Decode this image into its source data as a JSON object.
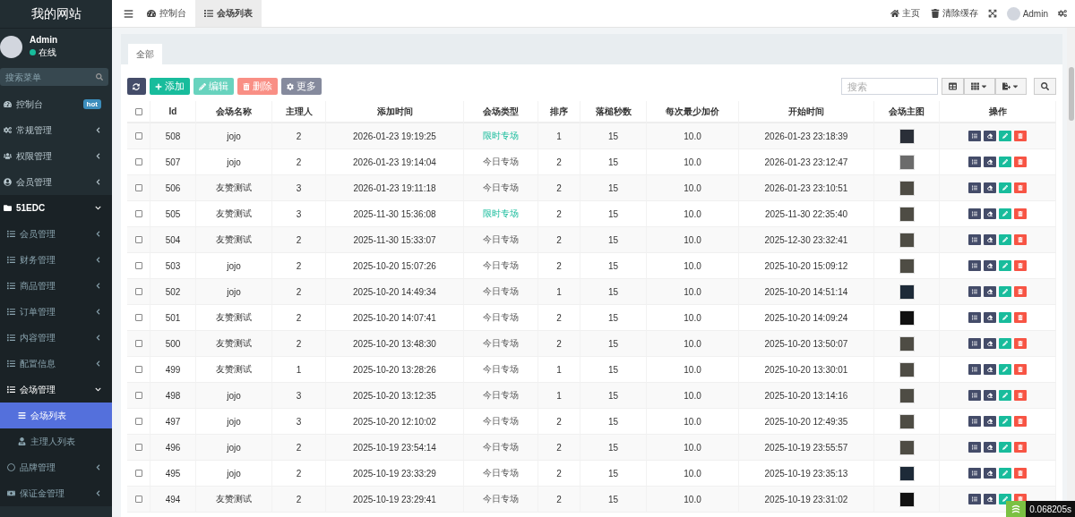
{
  "sidebar": {
    "logo": "我的网站",
    "user": {
      "name": "Admin",
      "status": "在线"
    },
    "search": {
      "placeholder": "搜索菜单"
    },
    "items": [
      {
        "label": "控制台",
        "badge": "hot",
        "selected": false
      },
      {
        "label": "常规管理",
        "expanded": false,
        "selected": false
      },
      {
        "label": "权限管理",
        "expanded": false,
        "selected": false
      },
      {
        "label": "会员管理",
        "expanded": false,
        "selected": false
      },
      {
        "label": "51EDC",
        "expanded": true,
        "selected": false,
        "children": [
          {
            "label": "会员管理",
            "expanded": false,
            "selected": false
          },
          {
            "label": "财务管理",
            "expanded": false,
            "selected": false
          },
          {
            "label": "商品管理",
            "expanded": false,
            "selected": false
          },
          {
            "label": "订单管理",
            "expanded": false,
            "selected": false
          },
          {
            "label": "内容管理",
            "expanded": false,
            "selected": false
          },
          {
            "label": "配置信息",
            "expanded": false,
            "selected": false
          },
          {
            "label": "会场管理",
            "expanded": true,
            "selected": false,
            "children": [
              {
                "label": "会场列表",
                "selected": true
              },
              {
                "label": "主理人列表",
                "selected": false
              }
            ]
          },
          {
            "label": "品牌管理",
            "expanded": false,
            "selected": false
          },
          {
            "label": "保证金管理",
            "expanded": false,
            "selected": false
          }
        ]
      }
    ]
  },
  "topnav": {
    "tabs": [
      {
        "label": "控制台",
        "selected": false
      },
      {
        "label": "会场列表",
        "selected": true
      }
    ],
    "links": [
      {
        "label": "主页"
      },
      {
        "label": "清除缓存"
      }
    ],
    "user": "Admin"
  },
  "panel": {
    "tabs": [
      {
        "label": "全部",
        "selected": true
      }
    ],
    "buttons": [
      {
        "kind": "refresh",
        "disabled": false
      },
      {
        "kind": "add",
        "label": "添加",
        "disabled": false
      },
      {
        "kind": "edit",
        "label": "编辑",
        "disabled": true
      },
      {
        "kind": "delete",
        "label": "删除",
        "disabled": true
      },
      {
        "kind": "more",
        "label": "更多",
        "disabled": true
      }
    ],
    "search": {
      "placeholder": "搜索"
    }
  },
  "table": {
    "all_checked": false,
    "columns": [
      "Id",
      "会场名称",
      "主理人",
      "添加时间",
      "会场类型",
      "排序",
      "落槌秒数",
      "每次最少加价",
      "开始时间",
      "会场主图",
      "操作"
    ],
    "rows": [
      {
        "checked": false,
        "id": "508",
        "name": "jojo",
        "host": "2",
        "added": "2026-01-23 19:19:25",
        "type": "限时专场",
        "type_highlighted": true,
        "sort": "1",
        "seconds": "15",
        "increment": "10.0",
        "start": "2026-01-23 23:18:39"
      },
      {
        "checked": false,
        "id": "507",
        "name": "jojo",
        "host": "2",
        "added": "2026-01-23 19:14:04",
        "type": "今日专场",
        "type_highlighted": false,
        "sort": "2",
        "seconds": "15",
        "increment": "10.0",
        "start": "2026-01-23 23:12:47"
      },
      {
        "checked": false,
        "id": "506",
        "name": "友赞测试",
        "host": "3",
        "added": "2026-01-23 19:11:18",
        "type": "今日专场",
        "type_highlighted": false,
        "sort": "2",
        "seconds": "15",
        "increment": "10.0",
        "start": "2026-01-23 23:10:51"
      },
      {
        "checked": false,
        "id": "505",
        "name": "友赞测试",
        "host": "3",
        "added": "2025-11-30 15:36:08",
        "type": "限时专场",
        "type_highlighted": true,
        "sort": "2",
        "seconds": "15",
        "increment": "10.0",
        "start": "2025-11-30 22:35:40"
      },
      {
        "checked": false,
        "id": "504",
        "name": "友赞测试",
        "host": "2",
        "added": "2025-11-30 15:33:07",
        "type": "今日专场",
        "type_highlighted": false,
        "sort": "2",
        "seconds": "15",
        "increment": "10.0",
        "start": "2025-12-30 23:32:41"
      },
      {
        "checked": false,
        "id": "503",
        "name": "jojo",
        "host": "2",
        "added": "2025-10-20 15:07:26",
        "type": "今日专场",
        "type_highlighted": false,
        "sort": "2",
        "seconds": "15",
        "increment": "10.0",
        "start": "2025-10-20 15:09:12"
      },
      {
        "checked": false,
        "id": "502",
        "name": "jojo",
        "host": "2",
        "added": "2025-10-20 14:49:34",
        "type": "今日专场",
        "type_highlighted": false,
        "sort": "1",
        "seconds": "15",
        "increment": "10.0",
        "start": "2025-10-20 14:51:14"
      },
      {
        "checked": false,
        "id": "501",
        "name": "友赞测试",
        "host": "2",
        "added": "2025-10-20 14:07:41",
        "type": "今日专场",
        "type_highlighted": false,
        "sort": "2",
        "seconds": "15",
        "increment": "10.0",
        "start": "2025-10-20 14:09:24"
      },
      {
        "checked": false,
        "id": "500",
        "name": "友赞测试",
        "host": "2",
        "added": "2025-10-20 13:48:30",
        "type": "今日专场",
        "type_highlighted": false,
        "sort": "2",
        "seconds": "15",
        "increment": "10.0",
        "start": "2025-10-20 13:50:07"
      },
      {
        "checked": false,
        "id": "499",
        "name": "友赞测试",
        "host": "1",
        "added": "2025-10-20 13:28:26",
        "type": "今日专场",
        "type_highlighted": false,
        "sort": "1",
        "seconds": "15",
        "increment": "10.0",
        "start": "2025-10-20 13:30:01"
      },
      {
        "checked": false,
        "id": "498",
        "name": "jojo",
        "host": "3",
        "added": "2025-10-20 13:12:35",
        "type": "今日专场",
        "type_highlighted": false,
        "sort": "1",
        "seconds": "15",
        "increment": "10.0",
        "start": "2025-10-20 13:14:16"
      },
      {
        "checked": false,
        "id": "497",
        "name": "jojo",
        "host": "3",
        "added": "2025-10-20 12:10:02",
        "type": "今日专场",
        "type_highlighted": false,
        "sort": "2",
        "seconds": "15",
        "increment": "10.0",
        "start": "2025-10-20 12:49:35"
      },
      {
        "checked": false,
        "id": "496",
        "name": "jojo",
        "host": "2",
        "added": "2025-10-19 23:54:14",
        "type": "今日专场",
        "type_highlighted": false,
        "sort": "2",
        "seconds": "15",
        "increment": "10.0",
        "start": "2025-10-19 23:55:57"
      },
      {
        "checked": false,
        "id": "495",
        "name": "jojo",
        "host": "2",
        "added": "2025-10-19 23:33:29",
        "type": "今日专场",
        "type_highlighted": false,
        "sort": "2",
        "seconds": "15",
        "increment": "10.0",
        "start": "2025-10-19 23:35:13"
      },
      {
        "checked": false,
        "id": "494",
        "name": "友赞测试",
        "host": "2",
        "added": "2025-10-19 23:29:41",
        "type": "今日专场",
        "type_highlighted": false,
        "sort": "2",
        "seconds": "15",
        "increment": "10.0",
        "start": "2025-10-19 23:31:02"
      }
    ]
  },
  "debug_bar": {
    "time": "0.068205s"
  }
}
